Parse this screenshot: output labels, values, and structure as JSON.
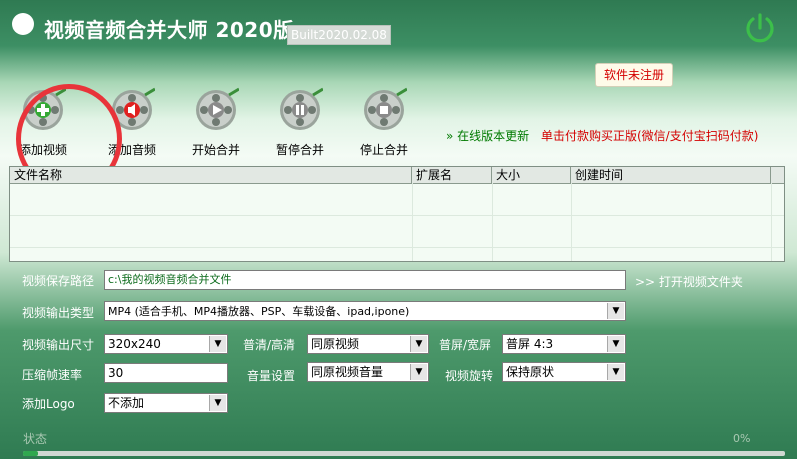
{
  "header": {
    "title": "视频音频合并大师 2020版",
    "build": "Built2020.02.08",
    "registration": "软件未注册"
  },
  "toolbar": {
    "items": [
      {
        "label": "添加视频",
        "icon": "add-icon",
        "accent": "#35a835"
      },
      {
        "label": "添加音频",
        "icon": "speaker-icon",
        "accent": "#e02020"
      },
      {
        "label": "开始合并",
        "icon": "play-icon",
        "accent": "#8a8a8a"
      },
      {
        "label": "暂停合并",
        "icon": "pause-icon",
        "accent": "#8a8a8a"
      },
      {
        "label": "停止合并",
        "icon": "stop-icon",
        "accent": "#8a8a8a"
      }
    ],
    "update_link": "» 在线版本更新",
    "buy_link": "单击付款购买正版(微信/支付宝扫码付款)"
  },
  "table": {
    "columns": [
      "文件名称",
      "扩展名",
      "大小",
      "创建时间"
    ],
    "rows": []
  },
  "form": {
    "save_path_label": "视频保存路径",
    "save_path_value": "c:\\我的视频音频合并文件",
    "open_folder": ">>  打开视频文件夹",
    "output_type_label": "视频输出类型",
    "output_type_value": "MP4 (适合手机、MP4播放器、PSP、车载设备、ipad,ipone)",
    "size_label": "视频输出尺寸",
    "size_value": "320x240",
    "quality_label": "普清/高清",
    "quality_value": "同原视频",
    "aspect_label": "普屏/宽屏",
    "aspect_value": "普屏 4:3",
    "fps_label": "压缩帧速率",
    "fps_value": "30",
    "volume_label": "音量设置",
    "volume_value": "同原视频音量",
    "rotate_label": "视频旋转",
    "rotate_value": "保持原状",
    "logo_label": "添加Logo",
    "logo_value": "不添加"
  },
  "status": {
    "label": "状态",
    "percent": "0%",
    "progress": 0.02
  },
  "colors": {
    "accent_green": "#2f7b52",
    "highlight_red": "#e8343a",
    "power_green": "#3cbf4a"
  }
}
